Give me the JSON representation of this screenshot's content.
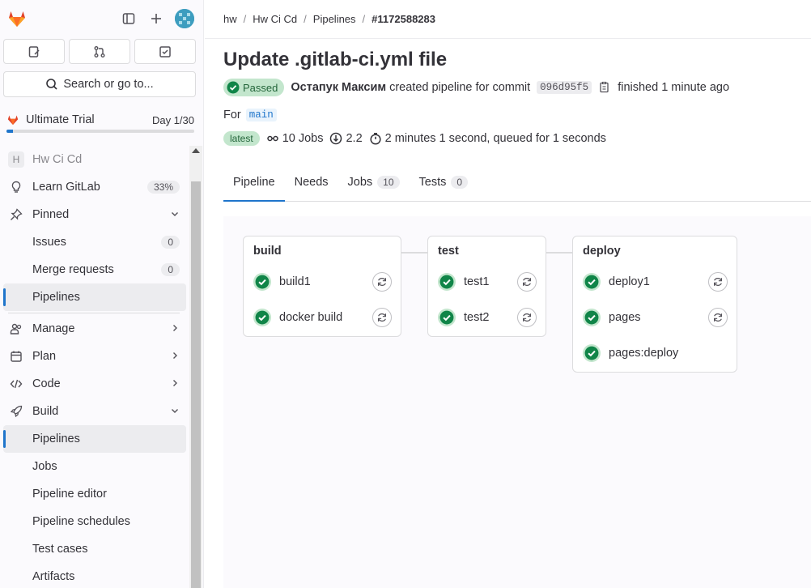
{
  "sidebar": {
    "search_label": "Search or go to...",
    "trial": {
      "name": "Ultimate Trial",
      "day": "Day 1/30",
      "progress_fraction": 0.033
    },
    "project": {
      "initial": "H",
      "name": "Hw Ci Cd"
    },
    "items": [
      {
        "label": "Learn GitLab",
        "count": "33%"
      },
      {
        "label": "Pinned"
      },
      {
        "label": "Issues",
        "count": "0"
      },
      {
        "label": "Merge requests",
        "count": "0"
      },
      {
        "label": "Pipelines"
      },
      {
        "label": "Manage"
      },
      {
        "label": "Plan"
      },
      {
        "label": "Code"
      },
      {
        "label": "Build"
      },
      {
        "label": "Pipelines"
      },
      {
        "label": "Jobs"
      },
      {
        "label": "Pipeline editor"
      },
      {
        "label": "Pipeline schedules"
      },
      {
        "label": "Test cases"
      },
      {
        "label": "Artifacts"
      }
    ]
  },
  "breadcrumb": [
    "hw",
    "Hw Ci Cd",
    "Pipelines",
    "#1172588283"
  ],
  "page": {
    "title": "Update .gitlab-ci.yml file",
    "status": "Passed",
    "author": "Остапук Максим",
    "created_text": "created pipeline for commit",
    "commit": "096d95f5",
    "finished_text": "finished 1 minute ago",
    "for_label": "For",
    "branch": "main",
    "latest": "latest",
    "jobs_count": "10 Jobs",
    "duration_value": "2.2",
    "duration_text": "2 minutes 1 second, queued for 1 seconds"
  },
  "tabs": [
    {
      "label": "Pipeline"
    },
    {
      "label": "Needs"
    },
    {
      "label": "Jobs",
      "count": "10"
    },
    {
      "label": "Tests",
      "count": "0"
    }
  ],
  "stages": [
    {
      "name": "build",
      "jobs": [
        "build1",
        "docker build"
      ]
    },
    {
      "name": "test",
      "jobs": [
        "test1",
        "test2"
      ]
    },
    {
      "name": "deploy",
      "jobs": [
        "deploy1",
        "pages",
        "pages:deploy"
      ]
    }
  ],
  "colors": {
    "accent": "#1f75cb",
    "success": "#108548",
    "success_bg": "#c3e6cd",
    "brand_orange": "#e24329"
  }
}
